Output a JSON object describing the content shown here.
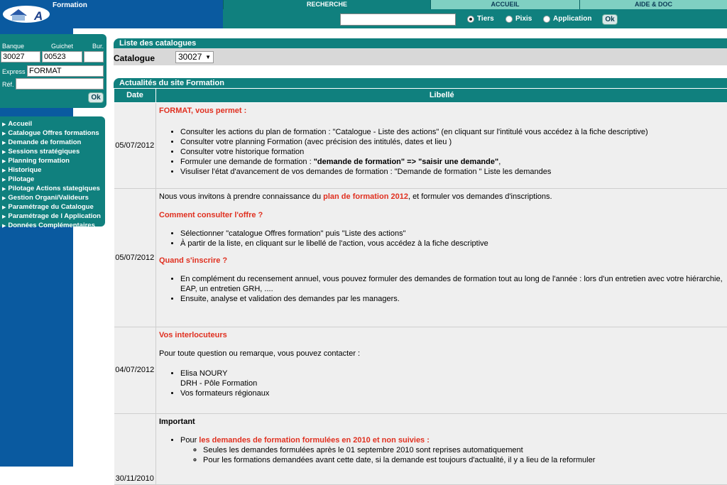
{
  "app": {
    "title": "Formation"
  },
  "tabs": [
    {
      "label": "RECHERCHE"
    },
    {
      "label": "ACCUEIL"
    },
    {
      "label": "AIDE & DOC"
    }
  ],
  "search": {
    "value": "",
    "options": [
      {
        "label": "Tiers",
        "checked": true
      },
      {
        "label": "Pixis",
        "checked": false
      },
      {
        "label": "Application",
        "checked": false
      }
    ],
    "ok_label": "Ok"
  },
  "bank_panel": {
    "banque_label": "Banque",
    "guichet_label": "Guichet",
    "bur_label": "Bur.",
    "banque_value": "30027",
    "guichet_value": "00523",
    "bur_value": "",
    "express_label": "Express",
    "express_value": "FORMAT",
    "ref_label": "Réf.",
    "ref_value": "",
    "ok_label": "Ok"
  },
  "menu": [
    "Accueil",
    "Catalogue Offres formations",
    "Demande de formation",
    "Sessions stratégiques",
    "Planning formation",
    "Historique",
    "Pilotage",
    "Pilotage Actions stategiques",
    "Gestion Organi/Valideurs",
    "Paramétrage du Catalogue",
    "Paramétrage de l Application",
    "Données Complémentaires"
  ],
  "catalogues": {
    "header": "Liste des catalogues",
    "label": "Catalogue",
    "selected": "30027"
  },
  "news": {
    "header": "Actualités du site Formation",
    "col_date": "Date",
    "col_label": "Libellé",
    "row1": {
      "date": "05/07/2012",
      "title": "FORMAT, vous permet :",
      "b1": "Consulter les actions du plan de formation : \"Catalogue - Liste des actions\" (en cliquant sur l'intitulé vous accédez à la fiche descriptive)",
      "b2": "Consulter votre planning Formation (avec précision des intitulés, dates et lieu )",
      "b3": "Consulter votre historique formation",
      "b4_pre": "Formuler une demande de formation : ",
      "b4_bold": "\"demande de formation\" => \"saisir une demande\"",
      "b4_post": ",",
      "b5": "Visuliser l'état d'avancement de vos demandes de formation : \"Demande de formation \" Liste les demandes"
    },
    "row2": {
      "date": "05/07/2012",
      "intro_pre": "Nous vous invitons à prendre connaissance du ",
      "intro_red": "plan de formation 2012",
      "intro_post": ", et formuler vos demandes d'inscriptions.",
      "h1": "Comment consulter l'offre ?",
      "b1": "Sélectionner \"catalogue Offres formation\" puis \"Liste des actions\"",
      "b2": "À partir de la liste, en cliquant sur le libellé de l'action, vous accédez à la fiche descriptive",
      "h2": "Quand s'inscrire ?",
      "b3": "En complément du recensement annuel, vous pouvez formuler des demandes de formation tout au long de l'année : lors d'un entretien avec votre hiérarchie, EAP, un entretien GRH, ....",
      "b4": "Ensuite, analyse et validation des demandes par les managers."
    },
    "row3": {
      "date": "04/07/2012",
      "title": "Vos interlocuteurs",
      "intro": "Pour toute question ou remarque, vous pouvez contacter :",
      "b1_line1": "Elisa NOURY",
      "b1_line2": "DRH - Pôle Formation",
      "b2": "Vos formateurs régionaux"
    },
    "row4": {
      "date": "30/11/2010",
      "title": "Important",
      "b1_pre": "Pour ",
      "b1_red": "les demandes de formation formulées en 2010 et non suivies :",
      "s1": "Seules les demandes formulées après le 01 septembre 2010 sont reprises automatiquement",
      "s2": "Pour les formations demandées avant cette date, si la demande est toujours d'actualité, il y a lieu de la reformuler"
    }
  }
}
